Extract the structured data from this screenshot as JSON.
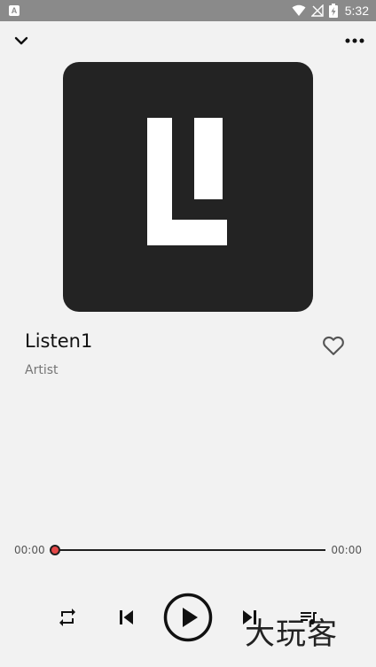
{
  "status_bar": {
    "app_icon_letter": "A",
    "time": "5:32"
  },
  "track": {
    "title": "Listen1",
    "artist": "Artist"
  },
  "progress": {
    "current_time": "00:00",
    "total_time": "00:00",
    "fraction": 0
  },
  "icons": {
    "collapse": "chevron-down-icon",
    "more": "more-horizontal-icon",
    "favorite": "heart-outline-icon",
    "repeat": "repeat-icon",
    "previous": "skip-previous-icon",
    "play": "play-circle-icon",
    "next": "skip-next-icon",
    "queue": "playlist-icon"
  },
  "watermark": "大玩客",
  "colors": {
    "background": "#f2f2f2",
    "album_bg": "#232323",
    "thumb": "#e54848",
    "status_bar": "#8a8a8a"
  }
}
